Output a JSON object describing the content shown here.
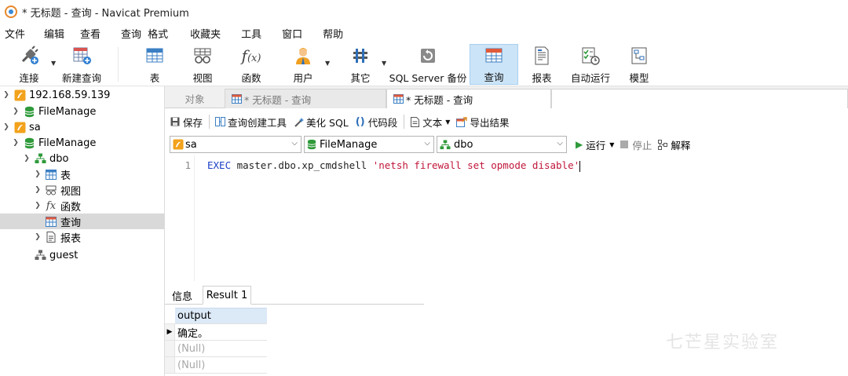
{
  "window": {
    "title": "* 无标题 - 查询 - Navicat Premium"
  },
  "menu": [
    "文件",
    "编辑",
    "查看",
    "查询",
    "格式",
    "收藏夹",
    "工具",
    "窗口",
    "帮助"
  ],
  "ribbon": {
    "connect": "连接",
    "new_query": "新建查询",
    "table": "表",
    "view": "视图",
    "function": "函数",
    "user": "用户",
    "other": "其它",
    "sql_backup": "SQL Server 备份",
    "query": "查询",
    "report": "报表",
    "auto_run": "自动运行",
    "model": "模型"
  },
  "tree": {
    "conn1": "192.168.59.139",
    "conn1_db": "FileManage",
    "conn2": "sa",
    "conn2_db": "FileManage",
    "schema": "dbo",
    "tables": "表",
    "views": "视图",
    "functions": "函数",
    "queries": "查询",
    "reports": "报表",
    "guest": "guest"
  },
  "tabs": {
    "objects": "对象",
    "tab1": "* 无标题 - 查询",
    "tab2": "* 无标题 - 查询"
  },
  "query_toolbar": {
    "save": "保存",
    "builder": "查询创建工具",
    "beautify": "美化 SQL",
    "snippet": "代码段",
    "text": "文本",
    "export": "导出结果"
  },
  "context": {
    "connection": "sa",
    "database": "FileManage",
    "schema": "dbo",
    "run": "运行",
    "stop": "停止",
    "explain": "解释"
  },
  "editor": {
    "line_number": "1",
    "keyword": "EXEC",
    "identifier": " master.dbo.xp_cmdshell ",
    "string": "'netsh firewall set opmode disable'"
  },
  "results": {
    "tab_info": "信息",
    "tab_result": "Result 1",
    "column": "output",
    "rows": [
      "确定。",
      "(Null)",
      "(Null)"
    ]
  },
  "watermark": "七芒星实验室"
}
